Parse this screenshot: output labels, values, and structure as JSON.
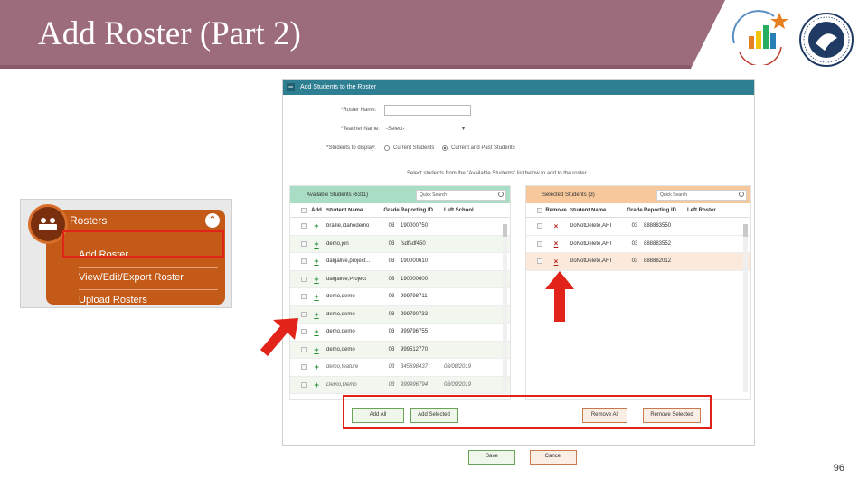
{
  "slide": {
    "title": "Add Roster (Part 2)",
    "page_number": "96",
    "banner_color": "#9c6b7c",
    "highlight_color": "#e2231a"
  },
  "logos": {
    "left": "testing-assessment-logo",
    "right": "state-education-seal"
  },
  "menu": {
    "header": "Rosters",
    "collapse_icon": "chevron-up-icon",
    "items": [
      {
        "label": "Add Roster"
      },
      {
        "label": "View/Edit/Export Roster"
      },
      {
        "label": "Upload Rosters"
      }
    ]
  },
  "app": {
    "header": "Add Students to the Roster",
    "roster_name_label": "*Roster Name:",
    "teacher_name_label": "*Teacher Name:",
    "teacher_select_value": "-Select-",
    "students_display_label": "*Students to display:",
    "radio_current": "Current Students",
    "radio_current_past": "Current and Past Students",
    "instruction": "Select students from the \"Available Students\" list below to add to the roster.",
    "available": {
      "title": "Available Students (6311)",
      "search_placeholder": "Quick Search",
      "columns": [
        "Add",
        "Student Name",
        "Grade",
        "Reporting ID",
        "Left School"
      ],
      "rows": [
        {
          "name": "braille,idahodemo",
          "grade": "03",
          "id": "190000750",
          "left": ""
        },
        {
          "name": "demo,jon",
          "grade": "03",
          "id": "fsdfsdf450",
          "left": ""
        },
        {
          "name": "dalgalive,project...",
          "grade": "03",
          "id": "190000610",
          "left": ""
        },
        {
          "name": "dalgalive,Project",
          "grade": "03",
          "id": "190000600",
          "left": ""
        },
        {
          "name": "demo,demo",
          "grade": "03",
          "id": "999798711",
          "left": ""
        },
        {
          "name": "demo,demo",
          "grade": "03",
          "id": "999790733",
          "left": ""
        },
        {
          "name": "demo,demo",
          "grade": "03",
          "id": "999796755",
          "left": ""
        },
        {
          "name": "demo,demo",
          "grade": "03",
          "id": "999512770",
          "left": ""
        },
        {
          "name": "demo,feature",
          "grade": "03",
          "id": "345698437",
          "left": "08/08/2019"
        },
        {
          "name": "Demo,Demo",
          "grade": "03",
          "id": "999996794",
          "left": "08/09/2019"
        }
      ],
      "add_all": "Add All",
      "add_selected": "Add Selected"
    },
    "selected": {
      "title": "Selected Students (3)",
      "search_placeholder": "Quick Search",
      "columns": [
        "Remove",
        "Student Name",
        "Grade",
        "Reporting ID",
        "Left Roster"
      ],
      "rows": [
        {
          "name": "DoNotDelete,AFT",
          "grade": "03",
          "id": "888883550"
        },
        {
          "name": "DoNotDelete,AFT",
          "grade": "03",
          "id": "888883552"
        },
        {
          "name": "DoNotDelete,AFT",
          "grade": "03",
          "id": "888882012"
        }
      ],
      "remove_all": "Remove All",
      "remove_selected": "Remove Selected"
    },
    "save": "Save",
    "cancel": "Cancel"
  }
}
